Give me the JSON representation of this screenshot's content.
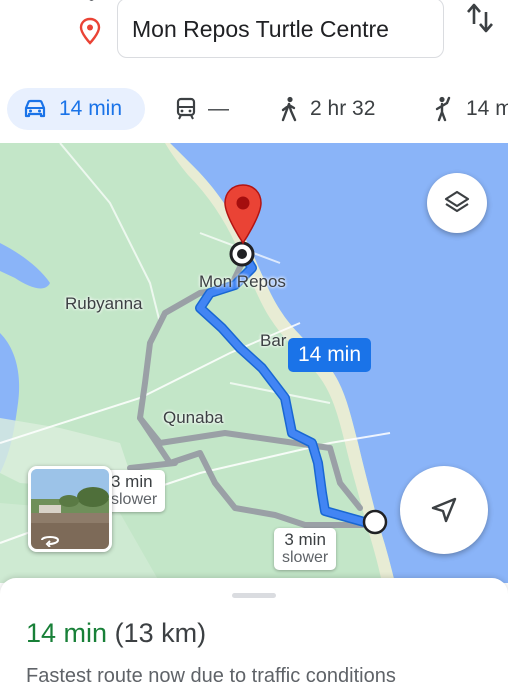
{
  "destination": {
    "value": "Mon Repos Turtle Centre"
  },
  "modes": [
    {
      "name": "drive",
      "label": "14 min",
      "active": true
    },
    {
      "name": "transit",
      "label": "—",
      "active": false
    },
    {
      "name": "walk",
      "label": "2 hr 32",
      "active": false
    },
    {
      "name": "rideshare",
      "label": "14 m",
      "active": false
    }
  ],
  "map": {
    "labels": {
      "mon_repos": "Mon Repos",
      "rubyanna": "Rubyanna",
      "bargara": "Bar",
      "qunaba": "Qunaba"
    },
    "route_callout": "14 min",
    "alt_routes": [
      {
        "time": "3 min",
        "note": "slower"
      },
      {
        "time": "3 min",
        "note": "slower"
      }
    ]
  },
  "sheet": {
    "time": "14 min",
    "distance": "(13 km)",
    "reason": "Fastest route now due to traffic conditions"
  },
  "colors": {
    "accent": "#1a73e8",
    "route": "#4285f4",
    "fastest": "#188038",
    "water": "#8ab4f8",
    "land": "#bfe3c4",
    "pin": "#ea4335"
  }
}
